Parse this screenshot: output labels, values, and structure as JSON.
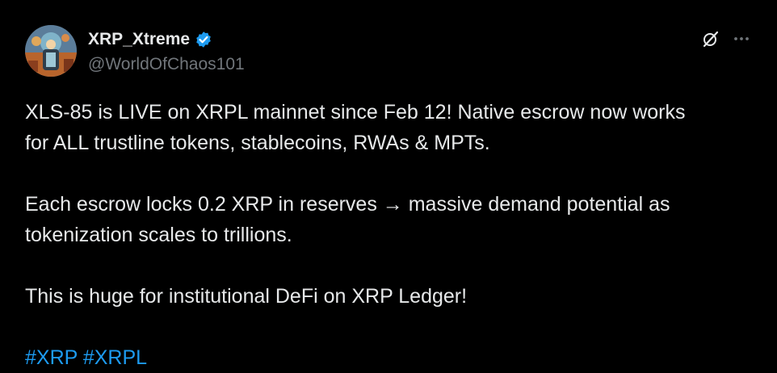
{
  "author": {
    "display_name": "XRP_Xtreme",
    "handle": "@WorldOfChaos101",
    "verified": true
  },
  "icons": {
    "verified": "verified-badge-icon",
    "grok": "grok-slash-icon",
    "more": "more-horizontal-icon"
  },
  "post": {
    "para1_line1": "XLS-85 is LIVE on XRPL mainnet since Feb 12!  Native escrow now works",
    "para1_line2": "for ALL trustline tokens, stablecoins, RWAs & MPTs.",
    "para2_line1": "Each escrow locks 0.2 XRP in reserves → massive demand potential as",
    "para2_line2": "tokenization scales to trillions.",
    "para3": "This is huge for institutional DeFi on XRP Ledger!",
    "hashtags": [
      "#XRP",
      "#XRPL"
    ]
  },
  "colors": {
    "background": "#000000",
    "text": "#e7e9ea",
    "muted": "#71767b",
    "accent": "#1d9bf0"
  }
}
